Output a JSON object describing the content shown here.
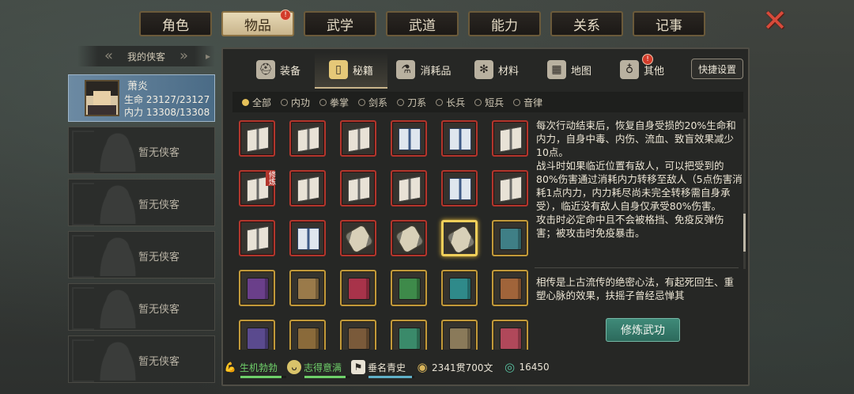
{
  "top_tabs": [
    {
      "label": "角色",
      "active": false,
      "badge": false
    },
    {
      "label": "物品",
      "active": true,
      "badge": true
    },
    {
      "label": "武学",
      "active": false,
      "badge": false
    },
    {
      "label": "武道",
      "active": false,
      "badge": false
    },
    {
      "label": "能力",
      "active": false,
      "badge": false
    },
    {
      "label": "关系",
      "active": false,
      "badge": false
    },
    {
      "label": "记事",
      "active": false,
      "badge": false
    }
  ],
  "badge_glyph": "!",
  "heroes": {
    "header": "我的侠客",
    "selected": {
      "name": "萧炎",
      "hp_line": "生命 23127/23127",
      "mp_line": "内力 13308/13308"
    },
    "empty_label": "暂无侠客"
  },
  "category_tabs": [
    {
      "label": "装备",
      "icon": "helmet-icon",
      "active": false,
      "badge": false
    },
    {
      "label": "秘籍",
      "icon": "scroll-icon",
      "active": true,
      "badge": false
    },
    {
      "label": "消耗品",
      "icon": "potion-icon",
      "active": false,
      "badge": false
    },
    {
      "label": "材料",
      "icon": "herb-icon",
      "active": false,
      "badge": false
    },
    {
      "label": "地图",
      "icon": "map-icon",
      "active": false,
      "badge": false
    },
    {
      "label": "其他",
      "icon": "lantern-icon",
      "active": false,
      "badge": true
    }
  ],
  "quick_settings": "快捷设置",
  "filters": [
    {
      "label": "全部",
      "selected": true
    },
    {
      "label": "内功",
      "selected": false
    },
    {
      "label": "拳掌",
      "selected": false
    },
    {
      "label": "剑系",
      "selected": false
    },
    {
      "label": "刀系",
      "selected": false
    },
    {
      "label": "长兵",
      "selected": false
    },
    {
      "label": "短兵",
      "selected": false
    },
    {
      "label": "音律",
      "selected": false
    }
  ],
  "item_tag": "修炼",
  "items": [
    {
      "frame": "red",
      "kind": "book-open"
    },
    {
      "frame": "red",
      "kind": "book-open"
    },
    {
      "frame": "red",
      "kind": "book-open"
    },
    {
      "frame": "red",
      "kind": "book-blue"
    },
    {
      "frame": "red",
      "kind": "book-blue"
    },
    {
      "frame": "red",
      "kind": "book-open"
    },
    {
      "frame": "red",
      "kind": "book-open",
      "tag": true
    },
    {
      "frame": "red",
      "kind": "book-open"
    },
    {
      "frame": "red",
      "kind": "book-open"
    },
    {
      "frame": "red",
      "kind": "book-open"
    },
    {
      "frame": "red",
      "kind": "book-blue"
    },
    {
      "frame": "red",
      "kind": "book-open"
    },
    {
      "frame": "red",
      "kind": "book-open"
    },
    {
      "frame": "red",
      "kind": "book-blue"
    },
    {
      "frame": "red",
      "kind": "scroll"
    },
    {
      "frame": "red",
      "kind": "scroll"
    },
    {
      "frame": "selected",
      "kind": "scroll"
    },
    {
      "frame": "gold",
      "kind": "book-color",
      "color": "#3f7f86"
    },
    {
      "frame": "gold",
      "kind": "book-color",
      "color": "#6a3f8a"
    },
    {
      "frame": "gold",
      "kind": "book-color",
      "color": "#9a7a4a"
    },
    {
      "frame": "gold",
      "kind": "book-color",
      "color": "#a8334a"
    },
    {
      "frame": "gold",
      "kind": "book-color",
      "color": "#3e8a4a"
    },
    {
      "frame": "gold",
      "kind": "book-color",
      "color": "#2f8a8a"
    },
    {
      "frame": "gold",
      "kind": "book-color",
      "color": "#a0643a"
    },
    {
      "frame": "gold",
      "kind": "book-color",
      "color": "#5a4a8e"
    },
    {
      "frame": "gold",
      "kind": "book-color",
      "color": "#8a6a3a"
    },
    {
      "frame": "gold",
      "kind": "book-color",
      "color": "#7a5a3a"
    },
    {
      "frame": "gold",
      "kind": "book-color",
      "color": "#3a8a6a"
    },
    {
      "frame": "gold",
      "kind": "book-color",
      "color": "#8a7a5a"
    },
    {
      "frame": "gold",
      "kind": "book-color",
      "color": "#b0485a"
    }
  ],
  "description": {
    "para1": "每次行动结束后，恢复自身受损的20%生命和内力，自身中毒、内伤、流血、致盲效果减少10点。",
    "para2": "战斗时如果临近位置有敌人，可以把受到的80%伤害通过消耗内力转移至敌人（5点伤害消耗1点内力，内力耗尽尚未完全转移需自身承受），临近没有敌人自身仅承受80%伤害。",
    "para3": "攻击时必定命中且不会被格挡、免疫反弹伤害；被攻击时免疫暴击。",
    "lore": "相传是上古流传的绝密心法，有起死回生、重塑心脉的效果，扶摇子曾经忌惮其"
  },
  "train_button": "修炼武功",
  "status": {
    "vitality": {
      "label": "生机勃勃",
      "icon": "strength-icon",
      "color": "#6fd06a",
      "level": 0.9
    },
    "mood": {
      "label": "志得意满",
      "icon": "face-icon",
      "color": "#6fd06a",
      "level": 0.9
    },
    "fame": {
      "label": "垂名青史",
      "icon": "flag-icon",
      "color": "#ece5d4",
      "level": 0.95
    },
    "money": {
      "label": "2341贯700文",
      "icon": "coin-icon"
    },
    "gems": {
      "label": "16450",
      "icon": "jade-icon"
    }
  }
}
